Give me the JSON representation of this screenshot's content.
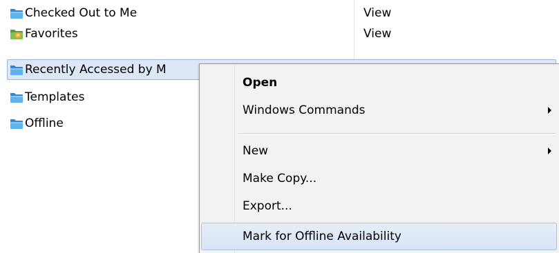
{
  "list": {
    "rows": [
      {
        "name": "Checked Out to Me",
        "type": "View",
        "icon": "blue-folder-icon"
      },
      {
        "name": "Favorites",
        "type": "View",
        "icon": "favorites-folder-icon"
      },
      {
        "name": "Recently Accessed by M",
        "type": "",
        "icon": "blue-folder-icon"
      },
      {
        "name": "Templates",
        "type": "",
        "icon": "blue-folder-icon"
      },
      {
        "name": "Offline",
        "type": "",
        "icon": "blue-folder-icon"
      }
    ],
    "selected_index": 2
  },
  "context_menu": {
    "items": [
      {
        "label": "Open",
        "bold": true,
        "submenu": false
      },
      {
        "label": "Windows Commands",
        "bold": false,
        "submenu": true
      },
      {
        "label": "New",
        "bold": false,
        "submenu": true
      },
      {
        "label": "Make Copy...",
        "bold": false,
        "submenu": false
      },
      {
        "label": "Export...",
        "bold": false,
        "submenu": false
      },
      {
        "label": "Mark for Offline Availability",
        "bold": false,
        "submenu": false,
        "highlighted": true
      }
    ]
  },
  "colors": {
    "selection_bg": "#dde8f7",
    "menu_bg": "#f2f2f2",
    "folder_blue": "#3f9ae0"
  }
}
